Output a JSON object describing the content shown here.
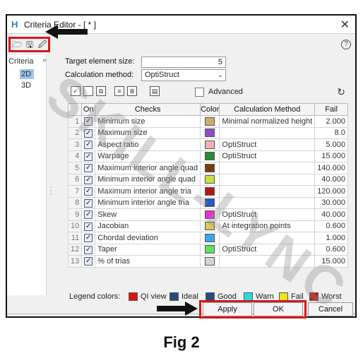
{
  "window": {
    "title": "Criteria Editor - [ * ]",
    "close_glyph": "✕"
  },
  "toolbar": {
    "icons": [
      "open-folder-icon",
      "save-icon",
      "save-as-icon"
    ],
    "help_glyph": "?"
  },
  "criteria_panel": {
    "label": "Criteria",
    "collapse_glyph": "»",
    "items": [
      "2D",
      "3D"
    ],
    "selected": "2D"
  },
  "form": {
    "target_size_label": "Target element size:",
    "target_size_value": "5",
    "method_label": "Calculation method:",
    "method_value": "OptiStruct",
    "advanced_label": "Advanced",
    "advanced_checked": false
  },
  "grid": {
    "headers": [
      "",
      "On",
      "Checks",
      "Color",
      "Calculation Method",
      "Fail"
    ],
    "rows": [
      {
        "num": "1",
        "check": "Minimum size",
        "color": "#c9b06a",
        "method": "Minimal normalized height",
        "fail": "2.000"
      },
      {
        "num": "2",
        "check": "Maximum size",
        "color": "#8a4fc6",
        "method": "",
        "fail": "8.0"
      },
      {
        "num": "3",
        "check": "Aspect ratio",
        "color": "#f2b2b0",
        "method": "OptiStruct",
        "fail": "5.000"
      },
      {
        "num": "4",
        "check": "Warpage",
        "color": "#2f8a2f",
        "method": "OptiStruct",
        "fail": "15.000"
      },
      {
        "num": "5",
        "check": "Maximum interior angle quad",
        "color": "#7a3b12",
        "method": "",
        "fail": "140.000"
      },
      {
        "num": "6",
        "check": "Minimum interior angle quad",
        "color": "#c8e040",
        "method": "",
        "fail": "40.000"
      },
      {
        "num": "7",
        "check": "Maximum interior angle tria",
        "color": "#b01818",
        "method": "",
        "fail": "120.000"
      },
      {
        "num": "8",
        "check": "Minimum interior angle tria",
        "color": "#2a56c8",
        "method": "",
        "fail": "30.000"
      },
      {
        "num": "9",
        "check": "Skew",
        "color": "#e830d8",
        "method": "OptiStruct",
        "fail": "40.000"
      },
      {
        "num": "10",
        "check": "Jacobian",
        "color": "#d8c85a",
        "method": "At integration points",
        "fail": "0.600"
      },
      {
        "num": "11",
        "check": "Chordal deviation",
        "color": "#3aa8e8",
        "method": "",
        "fail": "1.000"
      },
      {
        "num": "12",
        "check": "Taper",
        "color": "#5ee060",
        "method": "OptiStruct",
        "fail": "0.600"
      },
      {
        "num": "13",
        "check": "% of trias",
        "color": "#d4d4d4",
        "method": "",
        "fail": "15.000"
      }
    ]
  },
  "legend": {
    "label": "Legend colors:",
    "items": [
      {
        "name": "QI view",
        "color": "#e01010"
      },
      {
        "name": "Ideal",
        "color": "#2b4a7a"
      },
      {
        "name": "Good",
        "color": "#2b4a7a"
      },
      {
        "name": "Warn",
        "color": "#2ad8e0"
      },
      {
        "name": "Fail",
        "color": "#f4e020"
      },
      {
        "name": "Worst",
        "color": "#c01818"
      }
    ]
  },
  "buttons": {
    "apply": "Apply",
    "ok": "OK",
    "cancel": "Cancel"
  },
  "watermark": "SKILL-LYNC",
  "caption": "Fig 2"
}
